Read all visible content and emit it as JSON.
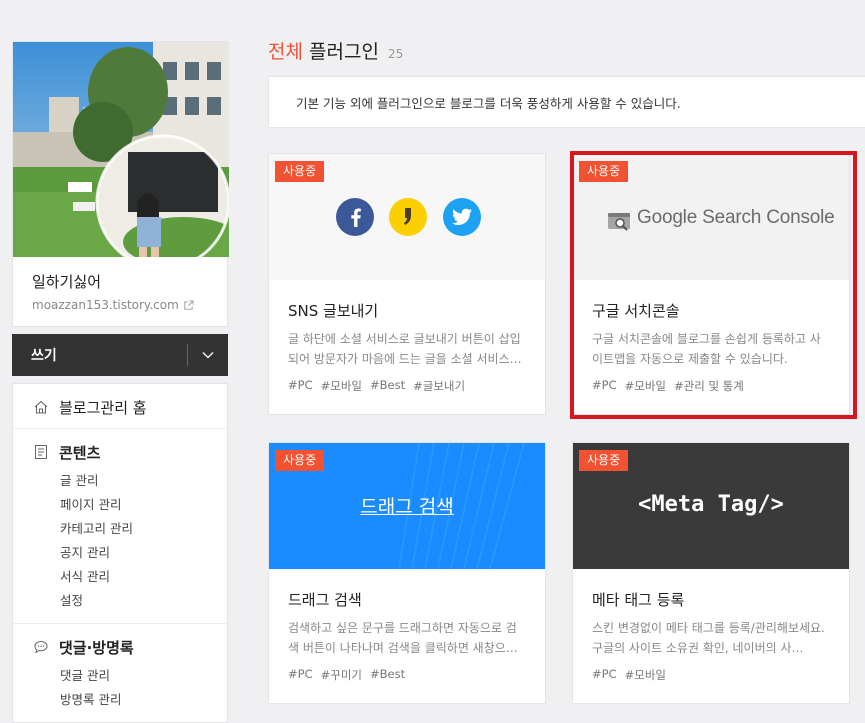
{
  "profile": {
    "name": "일하기싫어",
    "url": "moazzan153.tistory.com"
  },
  "write": {
    "label": "쓰기"
  },
  "menu": {
    "home": "블로그관리 홈",
    "contents": {
      "label": "콘텐츠",
      "items": [
        "글 관리",
        "페이지 관리",
        "카테고리 관리",
        "공지 관리",
        "서식 관리",
        "설정"
      ]
    },
    "comments": {
      "label": "댓글·방명록",
      "items": [
        "댓글 관리",
        "방명록 관리"
      ]
    }
  },
  "main": {
    "title_accent": "전체",
    "title_rest": "플러그인",
    "count": "25",
    "description": "기본 기능 외에 플러그인으로 블로그를 더욱 풍성하게 사용할 수 있습니다."
  },
  "colors": {
    "accent": "#f25132",
    "highlight": "#d9161f",
    "dark": "#333333"
  },
  "plugins": [
    {
      "badge": "사용중",
      "title": "SNS 글보내기",
      "desc": "글 하단에 소셜 서비스로 글보내기 버튼이 삽입되어 방문자가 마음에 드는 글을 소셜 서비스…",
      "tags": [
        "#PC",
        "#모바일",
        "#Best",
        "#글보내기"
      ]
    },
    {
      "badge": "사용중",
      "title": "구글 서치콘솔",
      "desc": "구글 서치콘솔에 블로그를 손쉽게 등록하고 사이트맵을 자동으로 제출할 수 있습니다.",
      "tags": [
        "#PC",
        "#모바일",
        "#관리 및 통계"
      ],
      "visual_text": "Google Search Console",
      "highlighted": true
    },
    {
      "badge": "사용중",
      "title": "드래그 검색",
      "desc": "검색하고 싶은 문구를 드래그하면 자동으로 검색 버튼이 나타나며 검색을 클릭하면 새창으…",
      "tags": [
        "#PC",
        "#꾸미기",
        "#Best"
      ],
      "visual_text": "드래그 검색"
    },
    {
      "badge": "사용중",
      "title": "메타 태그 등록",
      "desc": "스킨 변경없이 메타 태그를 등록/관리해보세요. 구글의 사이트 소유권 확인, 네이버의 사…",
      "tags": [
        "#PC",
        "#모바일"
      ],
      "visual_text": "<Meta Tag/>"
    }
  ]
}
